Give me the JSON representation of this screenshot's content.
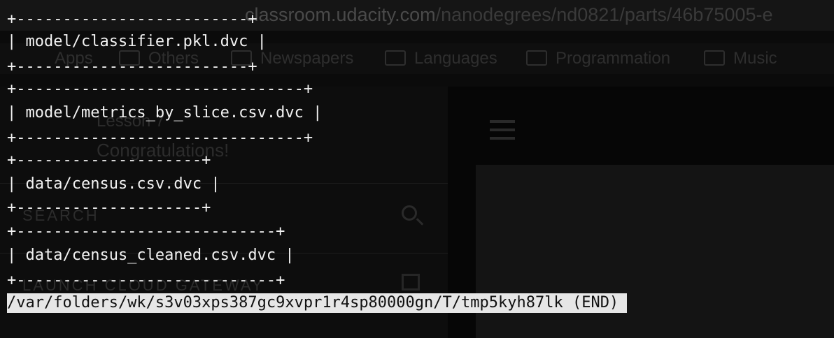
{
  "background_browser": {
    "url_host": "classroom.udacity.com",
    "url_path": "/nanodegrees/nd0821/parts/46b75005-e",
    "bookmarks": [
      "Apps",
      "Others",
      "Newspapers",
      "Languages",
      "Programmation",
      "Music"
    ],
    "sidebar": {
      "lesson_label": "Lesson 7",
      "lesson_title": "Congratulations!",
      "search_label": "SEARCH",
      "launch_label": "LAUNCH CLOUD GATEWAY"
    }
  },
  "terminal": {
    "lines": [
      "+-------------------------+",
      "| model/classifier.pkl.dvc |",
      "+-------------------------+",
      "+-------------------------------+",
      "| model/metrics_by_slice.csv.dvc |",
      "+-------------------------------+",
      "+--------------------+",
      "| data/census.csv.dvc |",
      "+--------------------+",
      "+----------------------------+",
      "| data/census_cleaned.csv.dvc |",
      "+----------------------------+"
    ],
    "pager_status": "/var/folders/wk/s3v03xps387gc9xvpr1r4sp80000gn/T/tmp5kyh87lk (END)"
  },
  "colors": {
    "terminal_text": "#f2f2f2",
    "terminal_background": "#000000",
    "selection_background": "#e6e6e6",
    "selection_text": "#111111"
  }
}
